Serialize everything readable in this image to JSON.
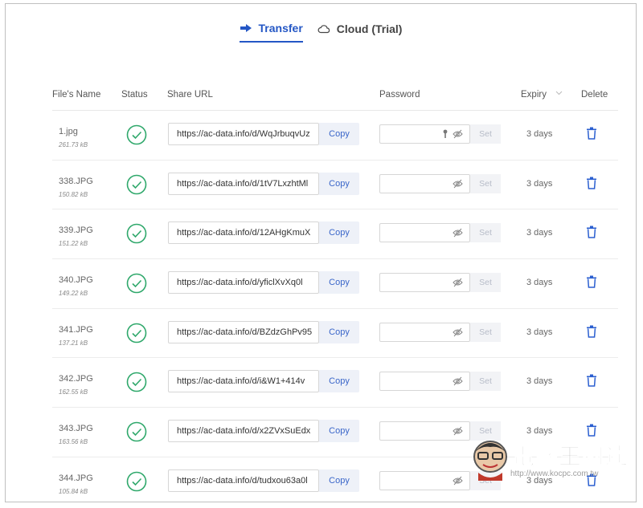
{
  "tabs": [
    {
      "label": "Transfer",
      "icon": "arrow-right-icon",
      "active": true
    },
    {
      "label": "Cloud (Trial)",
      "icon": "cloud-icon",
      "active": false
    }
  ],
  "headers": {
    "name": "File's Name",
    "status": "Status",
    "url": "Share URL",
    "password": "Password",
    "expiry": "Expiry",
    "delete": "Delete"
  },
  "buttons": {
    "copy": "Copy",
    "set": "Set"
  },
  "rows": [
    {
      "name": "1.jpg",
      "size": "261.73 kB",
      "url": "https://ac-data.info/d/WqJrbuqvUz",
      "expiry": "3 days",
      "key_icon": true
    },
    {
      "name": "338.JPG",
      "size": "150.82 kB",
      "url": "https://ac-data.info/d/1tV7LxzhtMl",
      "expiry": "3 days",
      "key_icon": false
    },
    {
      "name": "339.JPG",
      "size": "151.22 kB",
      "url": "https://ac-data.info/d/12AHgKmuX",
      "expiry": "3 days",
      "key_icon": false
    },
    {
      "name": "340.JPG",
      "size": "149.22 kB",
      "url": "https://ac-data.info/d/yficlXvXq0l",
      "expiry": "3 days",
      "key_icon": false
    },
    {
      "name": "341.JPG",
      "size": "137.21 kB",
      "url": "https://ac-data.info/d/BZdzGhPv95",
      "expiry": "3 days",
      "key_icon": false
    },
    {
      "name": "342.JPG",
      "size": "162.55 kB",
      "url": "https://ac-data.info/d/i&W1+414v",
      "expiry": "3 days",
      "key_icon": false
    },
    {
      "name": "343.JPG",
      "size": "163.56 kB",
      "url": "https://ac-data.info/d/x2ZVxSuEdx",
      "expiry": "3 days",
      "key_icon": false
    },
    {
      "name": "344.JPG",
      "size": "105.84 kB",
      "url": "https://ac-data.info/d/tudxou63a0l",
      "expiry": "3 days",
      "key_icon": false
    }
  ],
  "watermark": {
    "text": "電腦王阿達",
    "url": "http://www.kocpc.com.tw"
  },
  "colors": {
    "accent": "#2457c5",
    "status_ok": "#2fa86b",
    "copy_bg": "#eef1f8",
    "trash": "#2b5fd0"
  }
}
